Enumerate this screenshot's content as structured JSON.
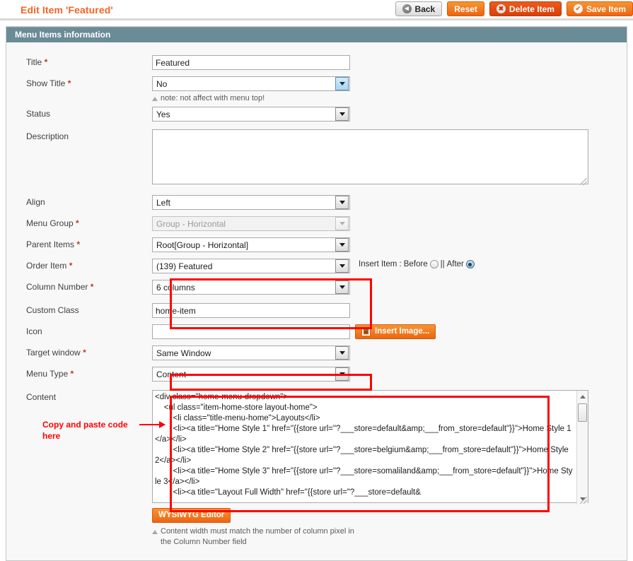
{
  "header": {
    "title": "Edit Item 'Featured'",
    "buttons": [
      {
        "id": "back",
        "label": "Back",
        "icon": "back-circle-icon"
      },
      {
        "id": "reset",
        "label": "Reset",
        "icon": ""
      },
      {
        "id": "delete",
        "label": "Delete Item",
        "icon": "close-circle-icon"
      },
      {
        "id": "save",
        "label": "Save Item",
        "icon": "check-circle-icon"
      }
    ]
  },
  "panel": {
    "heading": "Menu Items information"
  },
  "fields": {
    "title": {
      "label": "Title",
      "required": "*",
      "value": "Featured"
    },
    "show_title": {
      "label": "Show Title",
      "required": "*",
      "value": "No",
      "note": "note: not affect with menu top!"
    },
    "status": {
      "label": "Status",
      "required": "",
      "value": "Yes"
    },
    "description": {
      "label": "Description",
      "required": "",
      "value": ""
    },
    "align": {
      "label": "Align",
      "required": "",
      "value": "Left"
    },
    "menu_group": {
      "label": "Menu Group",
      "required": "*",
      "value": "Group - Horizontal"
    },
    "parent_items": {
      "label": "Parent Items",
      "required": "*",
      "value": "Root[Group - Horizontal]"
    },
    "order_item": {
      "label": "Order Item",
      "required": "*",
      "value": "(139) Featured",
      "insert_label": "Insert Item :",
      "insert_before": "Before",
      "insert_sep": "||",
      "insert_after": "After",
      "insert_selected": "After"
    },
    "column_number": {
      "label": "Column Number",
      "required": "*",
      "value": "6 columns"
    },
    "custom_class": {
      "label": "Custom Class",
      "required": "",
      "value": "home-item"
    },
    "icon": {
      "label": "Icon",
      "required": "",
      "value": "",
      "insert_image_label": "Insert Image...",
      "insert_image_icon": "image-icon"
    },
    "target_window": {
      "label": "Target window",
      "required": "*",
      "value": "Same Window"
    },
    "menu_type": {
      "label": "Menu Type",
      "required": "*",
      "value": "Content"
    },
    "content": {
      "label": "Content",
      "required": "",
      "value": "<div class=\"home-menu-dropdown\">\n    <ul class=\"item-home-store layout-home\">\n        <li class=\"title-menu-home\">Layouts</li>\n        <li><a title=\"Home Style 1\" href=\"{{store url=\"?___store=default&amp;___from_store=default\"}}\">Home Style 1</a></li>\n        <li><a title=\"Home Style 2\" href=\"{{store url=\"?___store=belgium&amp;___from_store=default\"}}\">Home Style 2</a></li>\n        <li><a title=\"Home Style 3\" href=\"{{store url=\"?___store=somaliland&amp;___from_store=default\"}}\">Home Style 3</a></li>\n        <li><a title=\"Layout Full Width\" href=\"{{store url=\"?___store=default&",
      "wysiwyg_label": "WYSIWYG Editor",
      "note_line1": "Content width must match the number of column pixel in",
      "note_line2": "the Column Number field"
    }
  },
  "annotations": {
    "copy_paste_line1": "Copy and paste code",
    "copy_paste_line2": "here",
    "color": "#ff0000"
  },
  "colors": {
    "accent_orange": "#f26522",
    "panel_header": "#6b8b96",
    "required_red": "#c0392b",
    "annotation_red": "#ff0000"
  }
}
